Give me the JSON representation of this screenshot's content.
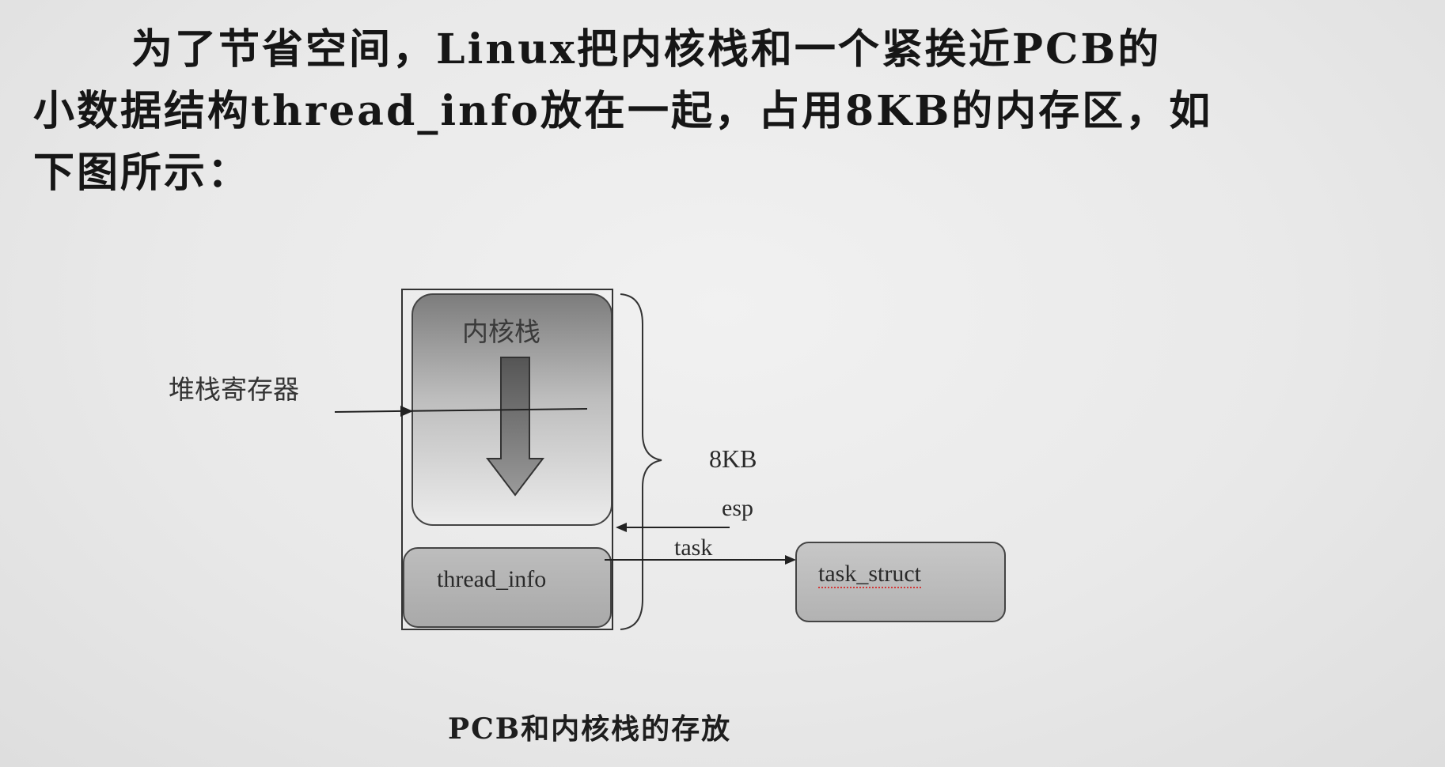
{
  "paragraph": {
    "line1": "为了节省空间，Linux把内核栈和一个紧挨近PCB的",
    "line2": "小数据结构thread_info放在一起，占用8KB的内存区，如",
    "line3": "下图所示："
  },
  "diagram": {
    "stack_register_label": "堆栈寄存器",
    "kernel_stack_label": "内核栈",
    "size_label": "8KB",
    "esp_label": "esp",
    "task_label": "task",
    "thread_info_label": "thread_info",
    "task_struct_label": "task_struct"
  },
  "caption": "PCB和内核栈的存放",
  "colors": {
    "background": "#ebebeb",
    "box_fill_light": "#d0d0d0",
    "box_fill_dark": "#7a7a7a",
    "stroke": "#333333",
    "spellcheck_underline": "#d23a3a"
  }
}
